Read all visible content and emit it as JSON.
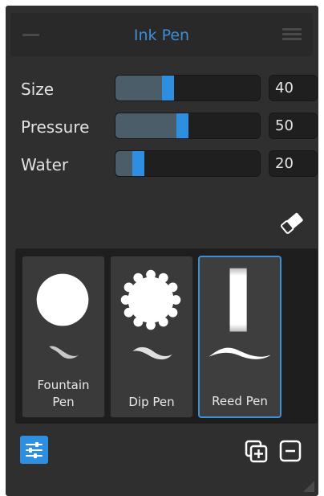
{
  "header": {
    "title": "Ink Pen",
    "minimize_icon": "minimize-icon",
    "menu_icon": "hamburger-menu-icon"
  },
  "sliders": [
    {
      "label": "Size",
      "value": "40",
      "fraction": 0.4
    },
    {
      "label": "Pressure",
      "value": "50",
      "fraction": 0.5
    },
    {
      "label": "Water",
      "value": "20",
      "fraction": 0.2
    }
  ],
  "eraser_icon": "eraser-icon",
  "presets": [
    {
      "label": "Fountain Pen",
      "shape": "circle",
      "selected": false
    },
    {
      "label": "Dip Pen",
      "shape": "scalloped-circle",
      "selected": false
    },
    {
      "label": "Reed Pen",
      "shape": "tall-rectangle",
      "selected": true
    }
  ],
  "bottom_bar": {
    "settings_icon": "sliders-settings-icon",
    "add_icon": "add-preset-icon",
    "remove_icon": "remove-preset-icon"
  },
  "colors": {
    "accent": "#2e8ee0",
    "title": "#3d8fd6",
    "panel_bg": "#2f2f2f"
  }
}
